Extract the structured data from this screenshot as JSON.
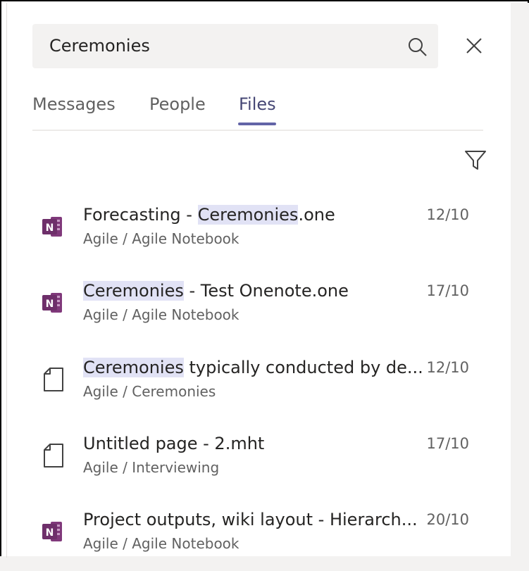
{
  "search": {
    "value": "Ceremonies"
  },
  "tabs": [
    {
      "label": "Messages",
      "active": false
    },
    {
      "label": "People",
      "active": false
    },
    {
      "label": "Files",
      "active": true
    }
  ],
  "files": [
    {
      "title_pre": "Forecasting - ",
      "title_hl": "Ceremonies",
      "title_post": ".one",
      "path": "Agile / Agile Notebook",
      "date": "12/10",
      "icon": "onenote-icon"
    },
    {
      "title_pre": "",
      "title_hl": "Ceremonies",
      "title_post": " - Test Onenote.one",
      "path": "Agile / Agile Notebook",
      "date": "17/10",
      "icon": "onenote-icon"
    },
    {
      "title_pre": "",
      "title_hl": "Ceremonies",
      "title_post": " typically conducted by de...",
      "path": "Agile / Ceremonies",
      "date": "12/10",
      "icon": "page-icon"
    },
    {
      "title_pre": "Untitled page - 2.mht",
      "title_hl": "",
      "title_post": "",
      "path": "Agile / Interviewing",
      "date": "17/10",
      "icon": "page-icon"
    },
    {
      "title_pre": "Project outputs, wiki layout - Hierarch...",
      "title_hl": "",
      "title_post": "",
      "path": "Agile / Agile Notebook",
      "date": "20/10",
      "icon": "onenote-icon"
    }
  ],
  "colors": {
    "accent": "#6264a7",
    "onenote": "#80397b",
    "highlight": "#e1e2f5"
  }
}
